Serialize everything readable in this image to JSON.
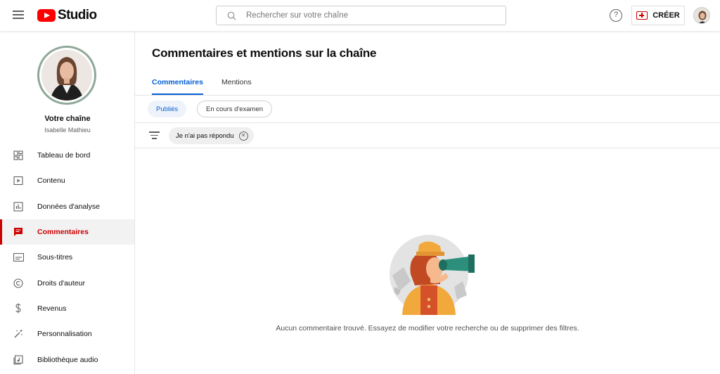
{
  "header": {
    "logo_text": "Studio",
    "search_placeholder": "Rechercher sur votre chaîne",
    "help_label": "?",
    "create_label": "CRÉER"
  },
  "channel": {
    "title": "Votre chaîne",
    "name": "Isabelle Mathieu"
  },
  "sidebar": {
    "items": [
      {
        "label": "Tableau de bord",
        "icon": "dashboard-icon"
      },
      {
        "label": "Contenu",
        "icon": "content-icon"
      },
      {
        "label": "Données d'analyse",
        "icon": "analytics-icon"
      },
      {
        "label": "Commentaires",
        "icon": "comments-icon",
        "active": true
      },
      {
        "label": "Sous-titres",
        "icon": "subtitles-icon"
      },
      {
        "label": "Droits d'auteur",
        "icon": "copyright-icon"
      },
      {
        "label": "Revenus",
        "icon": "dollar-icon"
      },
      {
        "label": "Personnalisation",
        "icon": "magic-wand-icon"
      },
      {
        "label": "Bibliothèque audio",
        "icon": "audio-library-icon"
      }
    ]
  },
  "main": {
    "title": "Commentaires et mentions sur la chaîne",
    "tabs": [
      {
        "label": "Commentaires",
        "active": true
      },
      {
        "label": "Mentions",
        "active": false
      }
    ],
    "subtabs": [
      {
        "label": "Publiés",
        "active": true
      },
      {
        "label": "En cours d'examen",
        "active": false
      }
    ],
    "filter_chip": "Je n'ai pas répondu",
    "empty_message": "Aucun commentaire trouvé. Essayez de modifier votre recherche ou de supprimer des filtres."
  },
  "colors": {
    "brand_red": "#ff0000",
    "active_red": "#cc0000",
    "link_blue": "#065fd4"
  }
}
